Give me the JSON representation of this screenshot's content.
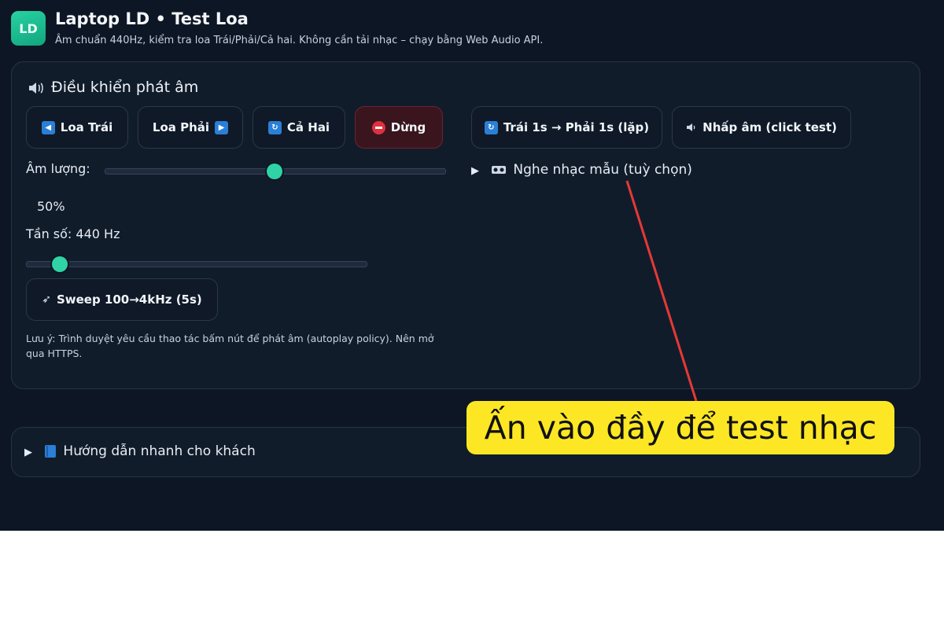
{
  "header": {
    "logo_text": "LD",
    "title": "Laptop LD • Test Loa",
    "subtitle": "Âm chuẩn 440Hz, kiểm tra loa Trái/Phải/Cả hai. Không cần tải nhạc – chạy bằng Web Audio API."
  },
  "controls": {
    "title": "Điều khiển phát âm",
    "title_icon": "speaker-icon",
    "buttons": {
      "left": "Loa Trái",
      "right": "Loa Phải",
      "both": "Cả Hai",
      "stop": "Dừng",
      "alternate": "Trái 1s → Phải 1s (lặp)",
      "click_test": "Nhấp âm (click test)",
      "sweep": "Sweep 100→4kHz (5s)"
    },
    "volume": {
      "label": "Âm lượng:",
      "value_text": "50%",
      "level": 0.5
    },
    "frequency": {
      "label": "Tần số: 440 Hz",
      "level": 0.1
    },
    "note": "Lưu ý: Trình duyệt yêu cầu thao tác bấm nút để phát âm (autoplay policy). Nên mở qua HTTPS.",
    "sample_music": {
      "label": "Nghe nhạc mẫu (tuỳ chọn)",
      "caret": "▶"
    }
  },
  "guide": {
    "label": "Hướng dẫn nhanh cho khách",
    "caret": "▶"
  },
  "callout": {
    "text": "Ấn vào đầy để test nhạc"
  },
  "colors": {
    "background": "#0d1624",
    "accent": "#2fd3a5",
    "stop": "#3a151d",
    "callout": "#fde725",
    "arrow": "#e53935"
  }
}
